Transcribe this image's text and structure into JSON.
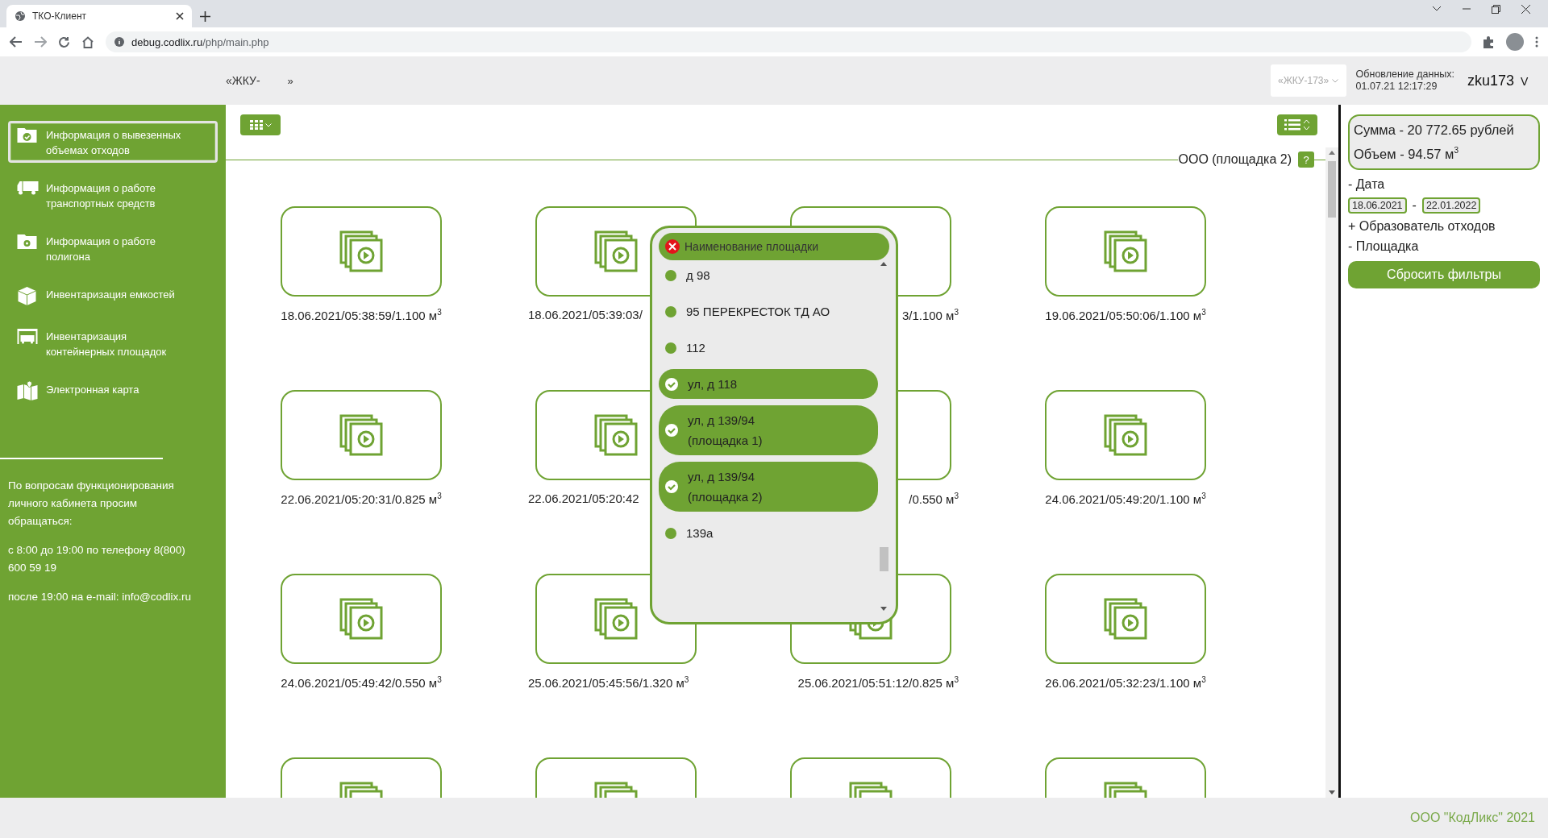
{
  "browser": {
    "tab_title": "ТКО-Клиент",
    "url_host": "debug.codlix.ru",
    "url_path": "/php/main.php"
  },
  "header": {
    "crumb_left": "«ЖКУ-",
    "crumb_right": "»",
    "account_select": "«ЖКУ-173»",
    "update_label": "Обновление данных:",
    "update_time": "01.07.21 12:17:29",
    "user": "zku173",
    "user_caret": "V"
  },
  "sidebar": {
    "items": [
      {
        "label": "Информация о вывезенных объемах отходов",
        "kind": "folder-check",
        "selected": true
      },
      {
        "label": "Информация о работе транспортных средств",
        "kind": "truck",
        "selected": false
      },
      {
        "label": "Информация о работе полигона",
        "kind": "folder-gear",
        "selected": false
      },
      {
        "label": "Инвентаризация емкостей",
        "kind": "box",
        "selected": false
      },
      {
        "label": "Инвентаризация контейнерных площадок",
        "kind": "garage",
        "selected": false
      },
      {
        "label": "Электронная карта",
        "kind": "map",
        "selected": false
      }
    ],
    "contact": [
      "По вопросам функционирования личного кабинета просим обращаться:",
      "с 8:00 до 19:00 по телефону 8(800) 600 59 19",
      "после 19:00 на e-mail: info@codlix.ru"
    ]
  },
  "content": {
    "title": "ООО (площадка 2)",
    "help": "?",
    "cards": [
      {
        "kind": "video",
        "label": "18.06.2021/05:38:59/1.100 м$^{3}$"
      },
      {
        "kind": "video",
        "label": "18.06.2021/05:39:03/"
      },
      {
        "kind": "video",
        "label": "3/1.100 м$^{3}$"
      },
      {
        "kind": "video",
        "label": "19.06.2021/05:50:06/1.100 м$^{3}$"
      },
      {
        "kind": "video",
        "label": "22.06.2021/05:20:31/0.825 м$^{3}$"
      },
      {
        "kind": "video",
        "label": "22.06.2021/05:20:42"
      },
      {
        "kind": "video",
        "label": "/0.550 м$^{3}$"
      },
      {
        "kind": "video",
        "label": "24.06.2021/05:49:20/1.100 м$^{3}$"
      },
      {
        "kind": "video",
        "label": "24.06.2021/05:49:42/0.550 м$^{3}$"
      },
      {
        "kind": "video",
        "label": "25.06.2021/05:45:56/1.320 м$^{3}$"
      },
      {
        "kind": "video",
        "label": "25.06.2021/05:51:12/0.825 м$^{3}$"
      },
      {
        "kind": "video",
        "label": "26.06.2021/05:32:23/1.100 м$^{3}$"
      },
      {
        "kind": "video"
      },
      {
        "kind": "video"
      },
      {
        "kind": "video"
      },
      {
        "kind": "video"
      }
    ]
  },
  "popup": {
    "title": "Наименование площадки",
    "items": [
      {
        "lines": [
          "д 98"
        ],
        "selected": false
      },
      {
        "lines": [
          "95 ПЕРЕКРЕСТОК ТД АО"
        ],
        "selected": false
      },
      {
        "lines": [
          "112"
        ],
        "selected": false
      },
      {
        "lines": [
          "ул, д 118"
        ],
        "selected": true
      },
      {
        "lines": [
          "ул, д 139/94",
          "(площадка 1)"
        ],
        "selected": true
      },
      {
        "lines": [
          "ул, д 139/94",
          "(площадка 2)"
        ],
        "selected": true
      },
      {
        "lines": [
          "139а"
        ],
        "selected": false
      }
    ]
  },
  "filters": {
    "sum": "Сумма - 20 772.65 рублей",
    "volume": "Объем - 94.57 м$^{3}$",
    "date_group": "- Дата",
    "date_from": "18.06.2021",
    "date_sep": "-",
    "date_to": "22.01.2022",
    "groups": [
      "+ Образователь отходов",
      "- Площадка"
    ],
    "reset_button": "Сбросить фильтры"
  },
  "footer": "ООО \"КодЛикс\" 2021"
}
